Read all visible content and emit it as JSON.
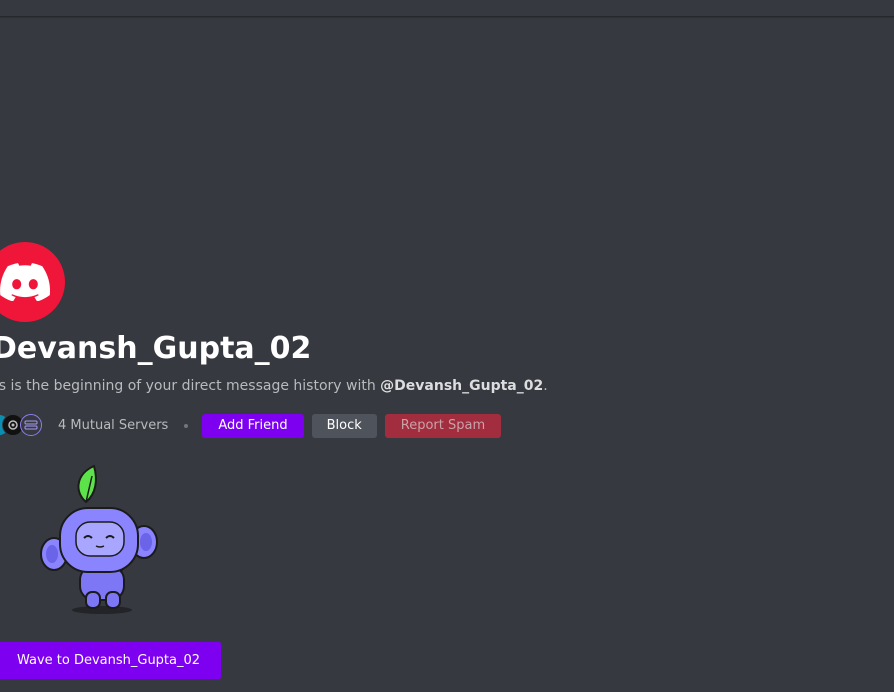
{
  "profile": {
    "username": "Devansh_Gupta_02",
    "intro_prefix": "his is the beginning of your direct message history with ",
    "intro_handle": "@Devansh_Gupta_02",
    "intro_suffix": ".",
    "avatar_icon": "discord-logo-icon",
    "avatar_color": "#f0163a"
  },
  "mutual": {
    "label": "4 Mutual Servers",
    "server_icons": [
      "server-icon-blue",
      "server-icon-dark",
      "server-icon-purple"
    ]
  },
  "actions": {
    "add_friend": "Add Friend",
    "block": "Block",
    "report_spam": "Report Spam"
  },
  "wave": {
    "button_label": "Wave to Devansh_Gupta_02",
    "illustration": "wumpus-waving-illustration"
  },
  "colors": {
    "background": "#36393f",
    "accent": "#7e00f0",
    "danger": "#a12d3e",
    "secondary": "#4f545c"
  }
}
